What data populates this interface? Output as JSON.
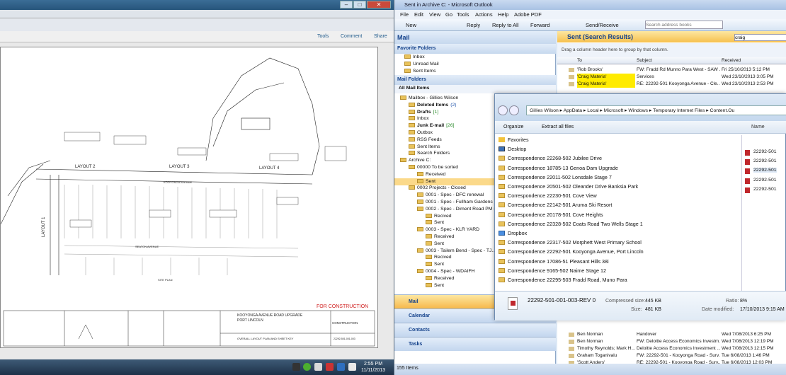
{
  "pdf": {
    "tools": "Tools",
    "comment": "Comment",
    "share": "Share",
    "drawing": {
      "layout2": "LAYOUT 2",
      "layout3": "LAYOUT 3",
      "layout4": "LAYOUT 4",
      "layout1": "LAYOUT 1",
      "street": "KOOYONGA AVENUE",
      "street2": "SEATON AVENUE",
      "siteplan": "SITE PLAN",
      "stamp": "FOR CONSTRUCTION",
      "title1": "KOOYONGA AVENUE ROAD UPGRADE",
      "title2": "PORT LINCOLN",
      "title3": "OVERALL LAYOUT PLAN AND SHEET KEY",
      "construction": "CONSTRUCTION",
      "docno": "22292-501-001-003"
    }
  },
  "taskbar": {
    "time": "2:55 PM",
    "date": "11/11/2013"
  },
  "outlook": {
    "title": "Sent in Archive C: - Microsoft Outlook",
    "menu": [
      "File",
      "Edit",
      "View",
      "Go",
      "Tools",
      "Actions",
      "Help",
      "Adobe PDF"
    ],
    "toolbar": {
      "new": "New",
      "reply": "Reply",
      "reply_all": "Reply to All",
      "forward": "Forward",
      "send_receive": "Send/Receive",
      "search_placeholder": "Search address books"
    },
    "nav": {
      "mail_header": "Mail",
      "favorites_header": "Favorite Folders",
      "favorites": [
        "Inbox",
        "Unread Mail",
        "Sent Items"
      ],
      "mail_folders_header": "Mail Folders",
      "all_mail": "All Mail Items",
      "tree": [
        {
          "label": "Mailbox - Gillies Wilson",
          "indent": 0
        },
        {
          "label": "Deleted Items",
          "count": "(2)",
          "indent": 1,
          "bold": true
        },
        {
          "label": "Drafts",
          "count": "[1]",
          "indent": 1,
          "bold": true
        },
        {
          "label": "Inbox",
          "indent": 1
        },
        {
          "label": "Junk E-mail",
          "count": "[26]",
          "indent": 1,
          "bold": true
        },
        {
          "label": "Outbox",
          "indent": 1
        },
        {
          "label": "RSS Feeds",
          "indent": 1
        },
        {
          "label": "Sent Items",
          "indent": 1
        },
        {
          "label": "Search Folders",
          "indent": 1
        },
        {
          "label": "Archive C:",
          "indent": 0
        },
        {
          "label": "00000 To be sorted",
          "indent": 1
        },
        {
          "label": "Received",
          "indent": 2
        },
        {
          "label": "Sent",
          "indent": 2,
          "selected": true
        },
        {
          "label": "0002 Projects - Closed",
          "indent": 1
        },
        {
          "label": "0001 - Spec - DFC renewal",
          "indent": 2
        },
        {
          "label": "0001 - Spec - Fullham Gardens",
          "indent": 2
        },
        {
          "label": "0002 - Spec - Diment Road PM re...",
          "indent": 2
        },
        {
          "label": "Recived",
          "indent": 3
        },
        {
          "label": "Sent",
          "indent": 3
        },
        {
          "label": "0003 - Spec - KLR YARD",
          "indent": 2
        },
        {
          "label": "Received",
          "indent": 3
        },
        {
          "label": "Sent",
          "indent": 3
        },
        {
          "label": "0003 - Tailem Bend - Spec - TJ...",
          "indent": 2
        },
        {
          "label": "Recived",
          "indent": 3
        },
        {
          "label": "Sent",
          "indent": 3
        },
        {
          "label": "0004 - Spec - WDAIFH",
          "indent": 2
        },
        {
          "label": "Received",
          "indent": 3
        },
        {
          "label": "Sent",
          "indent": 3
        }
      ],
      "buttons": [
        "Mail",
        "Calendar",
        "Contacts",
        "Tasks"
      ]
    },
    "list": {
      "header": "Sent (Search Results)",
      "search_value": "craig",
      "group_hint": "Drag a column header here to group by that column.",
      "columns": [
        "To",
        "Subject",
        "Received"
      ],
      "rows_top": [
        {
          "to": "'Rob Brooks'",
          "subject": "FW: Fradd Rd Munno Para West - SAW ...",
          "date": "Fri 25/10/2013 5:12 PM"
        },
        {
          "to": "'Craig Materia'",
          "subject": "Services",
          "date": "Wed 23/10/2013 3:05 PM"
        },
        {
          "to": "'Craig Materia'",
          "subject": "RE: 22292-501 Kooyonga Avenue - Cle...",
          "date": "Wed 23/10/2013 2:53 PM"
        }
      ],
      "rows_bottom": [
        {
          "to": "Ben Norman",
          "subject": "Handover",
          "date": "Wed 7/08/2013 6:25 PM"
        },
        {
          "to": "Ben Norman",
          "subject": "FW: Deloitte Access Economics Investm...",
          "date": "Wed 7/08/2013 12:19 PM"
        },
        {
          "to": "Timothy Reynolds; Mark H...",
          "subject": "Deloitte Access Economics Investment ...",
          "date": "Wed 7/08/2013 12:15 PM"
        },
        {
          "to": "Graham Toganivalu",
          "subject": "FW: 22292-501 - Kooyonga Road - Surv...",
          "date": "Tue 6/08/2013 1:46 PM"
        },
        {
          "to": "'Scott Anders'",
          "subject": "RE: 22292-501 - Kooyonga Road - Surv...",
          "date": "Tue 6/08/2013 12:03 PM"
        }
      ]
    },
    "status": "155 Items"
  },
  "explorer": {
    "breadcrumb": [
      "Gillies Wilson",
      "AppData",
      "Local",
      "Microsoft",
      "Windows",
      "Temporary Internet Files",
      "Content.Ou"
    ],
    "organize": "Organize",
    "extract": "Extract all files",
    "name_col": "Name",
    "items": [
      {
        "label": "Favorites",
        "type": "star"
      },
      {
        "label": "Desktop",
        "type": "desktop"
      },
      {
        "label": "Correspondence 22268-502 Jubilee Drive",
        "type": "folder"
      },
      {
        "label": "Correspondence 18785-13 Genoa Dam Upgrade",
        "type": "folder"
      },
      {
        "label": "Correspondence 22011-502 Lonsdale Stage 7",
        "type": "folder"
      },
      {
        "label": "Correspondence 20501-502 Oleander Drive Banksia Park",
        "type": "folder"
      },
      {
        "label": "Correspondence 22230-501 Cove View",
        "type": "folder"
      },
      {
        "label": "Correspondence 22142-501 Aruma Ski Resort",
        "type": "folder"
      },
      {
        "label": "Correspondence 20178-501 Cove Heights",
        "type": "folder"
      },
      {
        "label": "Correspondence 22328-502 Coats Road Two Wells Stage 1",
        "type": "folder"
      },
      {
        "label": "Dropbox",
        "type": "dropbox"
      },
      {
        "label": "Correspondence 22317-502 Morphett West Primary School",
        "type": "folder"
      },
      {
        "label": "Correspondence 22292-501 Kooyonga Avenue, Port Lincoln",
        "type": "folder"
      },
      {
        "label": "Correspondence 17086-51 Pleasant Hills 38i",
        "type": "folder"
      },
      {
        "label": "Correspondence 9165-502 Naime Stage 12",
        "type": "folder"
      },
      {
        "label": "Correspondence 22295-503 Fradd Road, Muno Para",
        "type": "folder"
      }
    ],
    "right_files": [
      "22292-501",
      "22292-501",
      "22292-501",
      "22292-501",
      "22292-501"
    ],
    "details": {
      "filename": "22292-501-001-003-REV 0",
      "compressed_label": "Compressed size:",
      "compressed": "445 KB",
      "size_label": "Size:",
      "size": "481 KB",
      "ratio_label": "Ratio:",
      "ratio": "8%",
      "modified_label": "Date modified:",
      "modified": "17/10/2013 9:15 AM"
    }
  }
}
